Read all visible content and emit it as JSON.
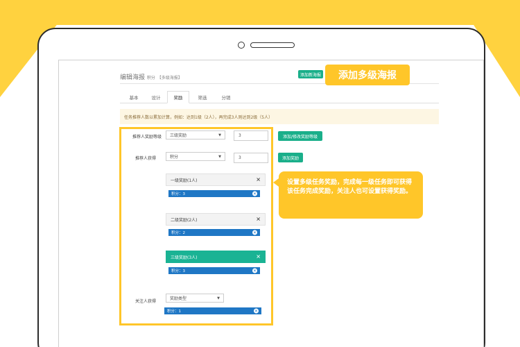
{
  "header": {
    "title": "编辑海报",
    "title_sub": "积分",
    "title_tag": "【多级海报】",
    "add_button": "添加新海报"
  },
  "tabs": [
    "基本",
    "设计",
    "奖励",
    "筛选",
    "分销"
  ],
  "notice": "任务推荐人数以累加计算，例如：达到1级（2人），再完成3人则达到2级（5人）",
  "form": {
    "level_label": "推荐人奖励等级",
    "level_select": "三级奖励",
    "level_value": "3",
    "level_button": "添加/修改奖励等级",
    "reward_label": "推荐人获得",
    "reward_select": "积分",
    "reward_value": "3",
    "reward_button": "添加奖励",
    "levels": [
      {
        "title": "一级奖励(1人)",
        "tag": "积分：3",
        "active": false
      },
      {
        "title": "二级奖励(2人)",
        "tag": "积分：2",
        "active": false
      },
      {
        "title": "三级奖励(3人)",
        "tag": "积分：3",
        "active": true
      }
    ],
    "follower_label": "关注人获得",
    "follower_select": "奖励类型",
    "follower_tag": "积分：1"
  },
  "callouts": {
    "title": "添加多级海报",
    "bubble": "设置多级任务奖励，完成每一级任务即可获得该任务完成奖励，关注人也可设置获得奖励。"
  },
  "icons": {
    "close": "close-icon",
    "caret": "caret-down-icon",
    "remove": "remove-tag-icon"
  },
  "colors": {
    "accent_yellow": "#ffc629",
    "button_green": "#1aaf8a",
    "tag_blue": "#1f77c5"
  }
}
